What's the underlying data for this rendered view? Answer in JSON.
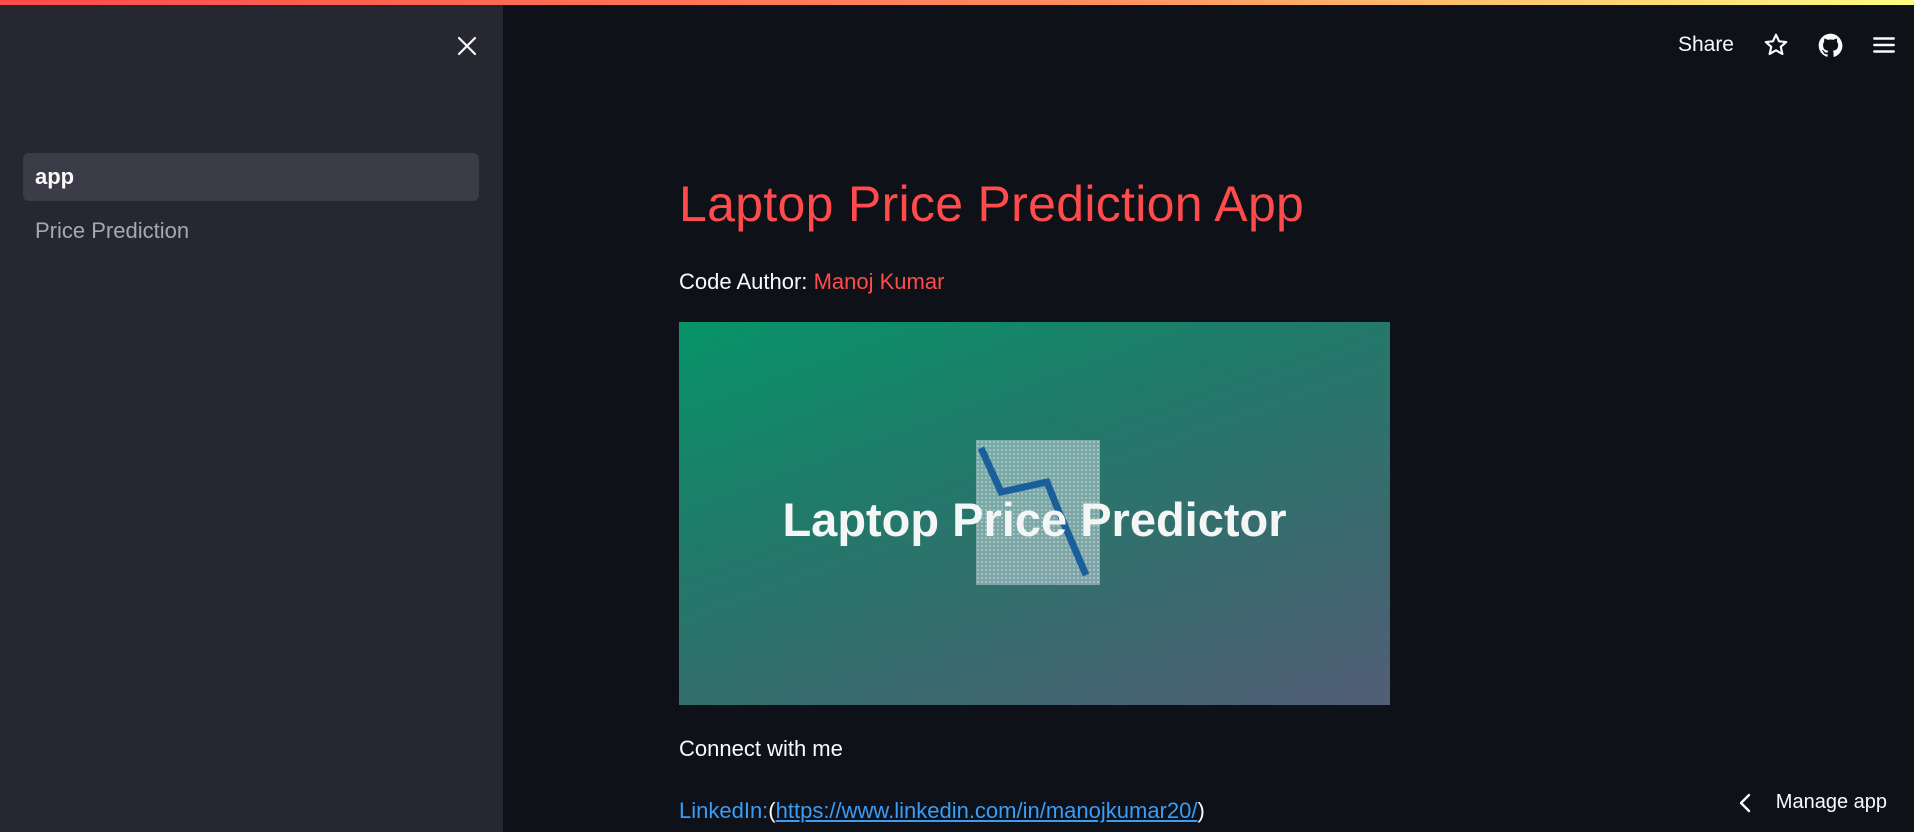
{
  "sidebar": {
    "close_icon": "close-icon",
    "items": [
      {
        "label": "app",
        "active": true
      },
      {
        "label": "Price Prediction",
        "active": false
      }
    ]
  },
  "toolbar": {
    "share_label": "Share",
    "icons": [
      "star-icon",
      "github-icon",
      "menu-icon"
    ]
  },
  "main": {
    "title": "Laptop Price Prediction App",
    "author_label": "Code Author:",
    "author_name": "Manoj Kumar",
    "banner": {
      "text": "Laptop Price Predictor",
      "colors": {
        "start": "#079467",
        "end": "#525d77",
        "line": "#1a5f9c"
      }
    },
    "connect_title": "Connect with me",
    "linkedin_label": "LinkedIn:",
    "linkedin_open": "(",
    "linkedin_url": "https://www.linkedin.com/in/manojkumar20/",
    "linkedin_close": ")"
  },
  "footer": {
    "manage_app_label": "Manage app",
    "chevron_icon": "chevron-left-icon"
  },
  "colors": {
    "accent": "#ff4b4b",
    "link": "#3a9cf5",
    "sidebar_bg": "#262730",
    "main_bg": "#0e1117"
  }
}
